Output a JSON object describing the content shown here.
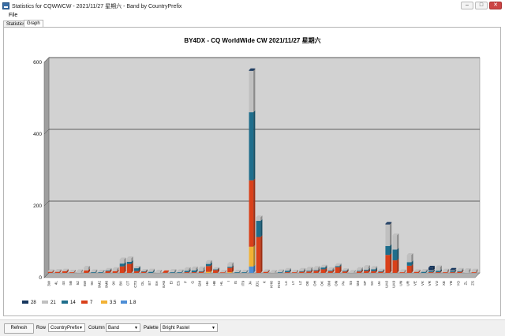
{
  "window": {
    "title": "Statistics for CQWWCW - 2021/11/27 星期六 - Band by CountryPrefix",
    "minimize": "–",
    "maximize": "□",
    "close": "✕"
  },
  "menu": {
    "file": "File"
  },
  "tabs": [
    {
      "label": "Statistics"
    },
    {
      "label": "Graph"
    }
  ],
  "chart_data": {
    "type": "bar",
    "stacked": true,
    "title": "BY4DX - CQ WorldWide CW 2021/11/27 星期六",
    "ylim": [
      0,
      600
    ],
    "yticks": [
      0,
      200,
      400,
      600
    ],
    "grid": true,
    "legend_position": "bottom-left",
    "categories": [
      "3W",
      "4L",
      "4X",
      "5B",
      "5Z",
      "6W",
      "9A",
      "9M2",
      "9M6",
      "9V",
      "BV",
      "CT",
      "CT3",
      "DL",
      "E7",
      "EA",
      "EA8",
      "EI",
      "ES",
      "F",
      "G",
      "GM",
      "HA",
      "HB",
      "HL",
      "I",
      "IS",
      "IT9",
      "JA",
      "JD1",
      "K",
      "KH0",
      "KH2",
      "LA",
      "LY",
      "LZ",
      "OE",
      "OH",
      "OK",
      "OM",
      "ON",
      "PA",
      "S5",
      "SM",
      "SP",
      "SV",
      "UA",
      "UA0",
      "UA9",
      "UN",
      "UR",
      "VE",
      "VK",
      "VR",
      "VU",
      "XE",
      "YB",
      "YO",
      "ZL",
      "ZS"
    ],
    "series": [
      {
        "name": "28",
        "color": "#17375e",
        "values": [
          0,
          0,
          0,
          0,
          0,
          0,
          0,
          0,
          0,
          0,
          0,
          0,
          0,
          0,
          0,
          0,
          0,
          0,
          0,
          0,
          0,
          0,
          0,
          0,
          0,
          0,
          0,
          0,
          2,
          0,
          0,
          0,
          0,
          0,
          0,
          0,
          0,
          0,
          0,
          0,
          0,
          0,
          0,
          0,
          0,
          0,
          0,
          2,
          0,
          0,
          0,
          0,
          0,
          8,
          0,
          0,
          2,
          0,
          0,
          0
        ]
      },
      {
        "name": "21",
        "color": "#c0c0c0",
        "values": [
          2,
          3,
          2,
          2,
          5,
          8,
          3,
          2,
          2,
          6,
          12,
          10,
          2,
          1,
          4,
          4,
          0,
          4,
          3,
          5,
          6,
          8,
          6,
          1,
          1,
          8,
          2,
          2,
          115,
          10,
          2,
          3,
          3,
          3,
          2,
          4,
          6,
          6,
          3,
          4,
          3,
          2,
          3,
          5,
          8,
          4,
          2,
          60,
          40,
          3,
          20,
          2,
          3,
          2,
          10,
          5,
          2,
          4,
          8,
          5
        ]
      },
      {
        "name": "14",
        "color": "#1f6e8c",
        "values": [
          0,
          0,
          0,
          0,
          0,
          0,
          2,
          2,
          2,
          0,
          8,
          6,
          8,
          2,
          3,
          0,
          0,
          2,
          2,
          4,
          5,
          2,
          6,
          2,
          0,
          3,
          2,
          2,
          190,
          45,
          0,
          0,
          2,
          4,
          0,
          2,
          2,
          2,
          5,
          2,
          3,
          2,
          0,
          2,
          3,
          5,
          2,
          25,
          30,
          0,
          10,
          0,
          3,
          3,
          4,
          0,
          3,
          2,
          0,
          0
        ]
      },
      {
        "name": "7",
        "color": "#d9401a",
        "values": [
          3,
          3,
          5,
          2,
          0,
          7,
          0,
          0,
          5,
          5,
          18,
          25,
          5,
          3,
          0,
          0,
          2,
          0,
          0,
          2,
          2,
          3,
          16,
          8,
          2,
          12,
          0,
          0,
          185,
          100,
          3,
          0,
          0,
          2,
          2,
          3,
          4,
          6,
          10,
          5,
          16,
          4,
          0,
          4,
          6,
          5,
          3,
          50,
          35,
          2,
          20,
          3,
          0,
          2,
          2,
          2,
          2,
          3,
          0,
          2
        ]
      },
      {
        "name": "3.5",
        "color": "#f2b234",
        "values": [
          0,
          0,
          0,
          0,
          0,
          0,
          0,
          0,
          0,
          0,
          0,
          0,
          0,
          0,
          0,
          0,
          0,
          0,
          0,
          0,
          0,
          0,
          3,
          0,
          0,
          2,
          0,
          0,
          55,
          0,
          0,
          0,
          0,
          0,
          0,
          0,
          0,
          0,
          0,
          0,
          0,
          0,
          0,
          0,
          0,
          0,
          0,
          0,
          0,
          0,
          0,
          0,
          0,
          0,
          0,
          0,
          0,
          0,
          0,
          0
        ]
      },
      {
        "name": "1.8",
        "color": "#4d8ed6",
        "values": [
          0,
          0,
          0,
          0,
          0,
          0,
          0,
          0,
          0,
          0,
          0,
          0,
          0,
          0,
          0,
          0,
          0,
          0,
          0,
          0,
          0,
          0,
          0,
          0,
          0,
          0,
          0,
          0,
          18,
          0,
          0,
          0,
          0,
          0,
          0,
          0,
          0,
          0,
          0,
          0,
          0,
          0,
          0,
          0,
          0,
          0,
          0,
          0,
          0,
          0,
          0,
          0,
          0,
          0,
          0,
          0,
          0,
          0,
          0,
          0
        ]
      }
    ]
  },
  "toolbar": {
    "refresh_label": "Refresh",
    "row_label": "Row",
    "row_value": "CountryPrefix",
    "column_label": "Column",
    "column_value": "Band",
    "palette_label": "Palette",
    "palette_value": "Bright Pastel"
  }
}
